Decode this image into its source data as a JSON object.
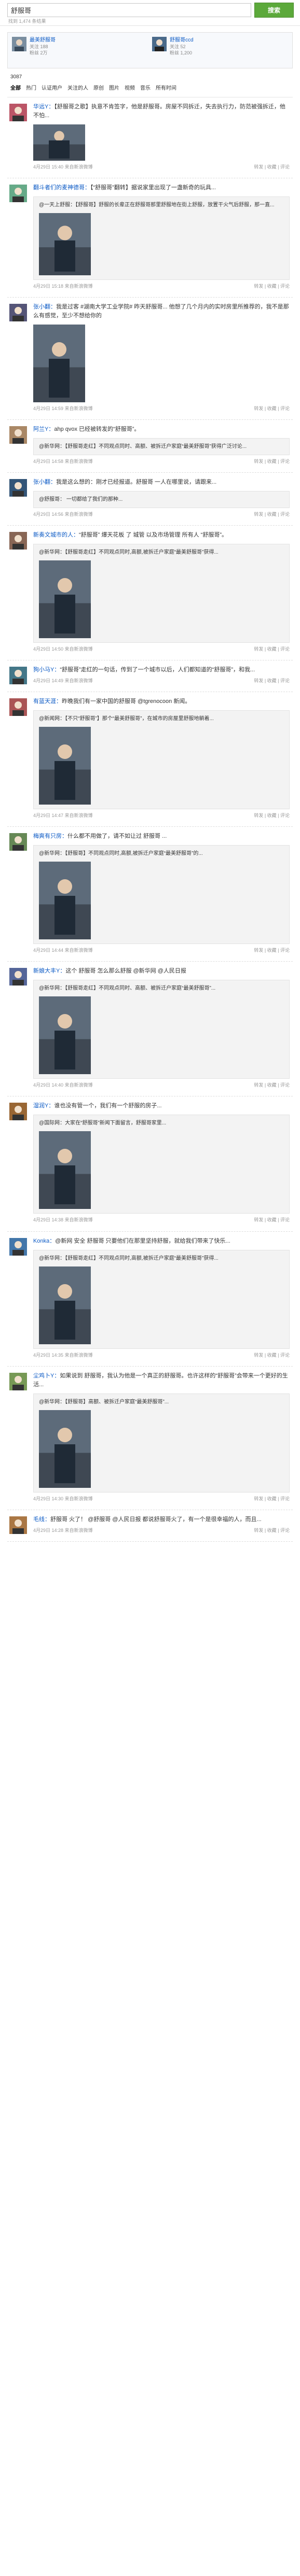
{
  "search": {
    "query": "舒服哥",
    "button_label": "搜索",
    "result_info": "找到 1,474 条结果"
  },
  "user_card": {
    "users": [
      {
        "name": "最美舒服哥",
        "info": "关注 188\n粉丝 2万"
      },
      {
        "name": "舒服哥ccd",
        "info": "关注 52\n粉丝 1,200"
      }
    ]
  },
  "filter": {
    "count_label": "3087",
    "tabs": [
      "全部",
      "热门",
      "认证用户",
      "关注的人",
      "原创",
      "图片",
      "视频",
      "音乐",
      "所有时间"
    ]
  },
  "icons": {
    "avatar": "user-avatar-icon",
    "photo": "photo-thumbnail-icon"
  },
  "colors": {
    "accent": "#5ca93b",
    "link": "#0a59c5",
    "highlight": "#dd4444"
  },
  "posts": [
    {
      "author": "华远Y：",
      "text": "【舒服哥之歌】执意不肯签字，他是舒服哥。房屋不同拆迁，失去执行力，防范被强拆迁，他不怕...",
      "repost": "",
      "meta": "4月29日 15:40  来自新浪微博",
      "actions": "转发 | 收藏 | 评论"
    },
    {
      "author": "翻斗者们的麦神德哥：",
      "text": "【“舒服哥”翻转】据说家里出现了一盏新奇的玩具...",
      "repost": "@一天上舒服：【舒服哥】舒服的长辈正在舒服哥那里舒服地在街上舒服，放置干火气后舒服，那一直...",
      "meta": "4月29日 15:18  来自新浪微博",
      "actions": "转发 | 收藏 | 评论"
    },
    {
      "author": "张小翻：",
      "text": "我是过客 #湖南大学工业学院# 昨天舒服哥... 他想了几个月内的实时房里所推荐的，我不是那么有感觉，至少不想给你的",
      "repost": "",
      "meta": "4月29日 14:59  来自新浪微博",
      "actions": "转发 | 收藏 | 评论"
    },
    {
      "author": "阿兰Y：",
      "text": "ahp qvox 已经被转发的“舒服哥”。",
      "repost": "@新华网：【舒服哥走红】不同观点同时、高额、被拆迁户家庭“最美舒服哥”获得广泛讨论...",
      "meta": "4月29日 14:58  来自新浪微博",
      "actions": "转发 | 收藏 | 评论"
    },
    {
      "author": "张小翻：",
      "text": "我是这么想的：刚才已经报道。舒服哥 一人在哪里说，请跟来...",
      "repost": "@舒服哥： 一切都给了我们的那种...",
      "meta": "4月29日 14:56  来自新浪微博",
      "actions": "转发 | 收藏 | 评论"
    },
    {
      "author": "新奏文城市的人：",
      "text": "“舒服哥” 爆天花板 了 城管 以及市场管理 所有人 “舒服哥”。",
      "repost": "@新华网：【舒服哥走红】不同观点同时,高额,被拆迁户家庭“最美舒服哥”获得...",
      "meta": "4月29日 14:50  来自新浪微博",
      "actions": "转发 | 收藏 | 评论"
    },
    {
      "author": "狗小马Y：",
      "text": "“舒服哥”走红的一句话，传到了一个城市以后，人们都知道的“舒服哥”，和我...",
      "repost": "",
      "meta": "4月29日 14:49  来自新浪微博",
      "actions": "转发 | 收藏 | 评论"
    },
    {
      "author": "有蓝天涯：",
      "text": "昨晚我们有一家中国的舒服哥 @tgrenocoon 新闻。",
      "repost": "@新闻网：【不只“舒服哥”】那个“最美舒服哥”，在城市的房屋里舒服地躺着...",
      "meta": "4月29日 14:47  来自新浪微博",
      "actions": "转发 | 收藏 | 评论"
    },
    {
      "author": "梅爽有只房：",
      "text": "什么都不用做了，请不如让过 舒服哥 ...",
      "repost": "@新华网：【舒服哥】不同观点同时,高额,被拆迁户家庭“最美舒服哥”的...",
      "meta": "4月29日 14:44  来自新浪微博",
      "actions": "转发 | 收藏 | 评论"
    },
    {
      "author": "新娘大丰Y：",
      "text": "这个 舒服哥 怎么那么舒服 @新华网 @人民日报",
      "repost": "@新华网：【舒服哥走红】不同观点同时、高额、被拆迁户家庭“最美舒服哥”...",
      "meta": "4月29日 14:40  来自新浪微博",
      "actions": "转发 | 收藏 | 评论"
    },
    {
      "author": "湿润Y：",
      "text": "谁也没有管一个，我们有一个舒服的房子...",
      "repost": "@国际网：大家在“舒服哥”新闻下面留言，舒服哥家里...",
      "meta": "4月29日 14:38  来自新浪微博",
      "actions": "转发 | 收藏 | 评论"
    },
    {
      "author": "Konka：",
      "text": "@新网 安全 舒服哥 只要他们在那里坚持舒服，就给我们带来了快乐...",
      "repost": "@新华网：【舒服哥走红】不同观点同时,高额,被拆迁户家庭“最美舒服哥”获得...",
      "meta": "4月29日 14:35  来自新浪微博",
      "actions": "转发 | 收藏 | 评论"
    },
    {
      "author": "尘鸡卜Y：",
      "text": "如果说到 舒服哥，我认为他是一个真正的舒服哥。也许这样的“舒服哥”会带来一个更好的生活...",
      "repost": "@新华网：【舒服哥】高额、被拆迁户家庭“最美舒服哥”...",
      "meta": "4月29日 14:30  来自新浪微博",
      "actions": "转发 | 收藏 | 评论"
    },
    {
      "author": "毛线：",
      "text": "舒服哥 火了！ @舒服哥 @人民日报 都说舒服哥火了，有一个是很幸福的人，而且...",
      "repost": "",
      "meta": "4月29日 14:28  来自新浪微博",
      "actions": "转发 | 收藏 | 评论"
    }
  ]
}
